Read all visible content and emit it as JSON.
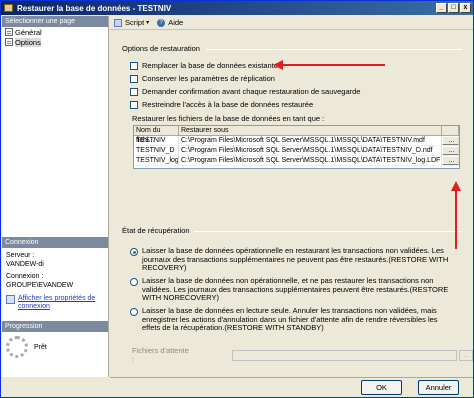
{
  "window": {
    "title": "Restaurer la base de données - TESTNIV",
    "min_label": "_",
    "max_label": "□",
    "close_label": "x"
  },
  "sidebar": {
    "header": "Sélectionner une page",
    "items": [
      {
        "label": "Général",
        "icon": "page-icon"
      },
      {
        "label": "Options",
        "icon": "page-icon"
      }
    ],
    "connection": {
      "header": "Connexion",
      "server_label": "Serveur :",
      "server_value": "VANDEW-di",
      "conn_label": "Connexion :",
      "conn_value": "GROUPE\\EVANDEW",
      "view_props_link": "Afficher les propriétés de connexion"
    },
    "progress": {
      "header": "Progression",
      "status": "Prêt"
    }
  },
  "toolbar": {
    "script_label": "Script",
    "help_label": "Aide"
  },
  "restore_options": {
    "group_label": "Options de restauration",
    "checkboxes": [
      {
        "label": "Remplacer la base de données existante",
        "checked": false
      },
      {
        "label": "Conserver les paramètres de réplication",
        "checked": false
      },
      {
        "label": "Demander confirmation avant chaque restauration de sauvegarde",
        "checked": false
      },
      {
        "label": "Restreindre l'accès à la base de données restaurée",
        "checked": false
      }
    ]
  },
  "files_grid": {
    "label": "Restaurer les fichiers de la base de données en tant que :",
    "columns": [
      "Nom du fichi...",
      "Restaurer sous"
    ],
    "rows": [
      {
        "name": "TESTNIV",
        "path": "C:\\Program Files\\Microsoft SQL Server\\MSSQL.1\\MSSQL\\DATA\\TESTNIV.mdf",
        "button": "..."
      },
      {
        "name": "TESTNIV_D",
        "path": "C:\\Program Files\\Microsoft SQL Server\\MSSQL.1\\MSSQL\\DATA\\TESTNIV_D.ndf",
        "button": "..."
      },
      {
        "name": "TESTNIV_log",
        "path": "C:\\Program Files\\Microsoft SQL Server\\MSSQL.1\\MSSQL\\DATA\\TESTNIV_log.LDF",
        "button": "..."
      }
    ]
  },
  "recovery": {
    "group_label": "État de récupération",
    "options": [
      {
        "text": "Laisser la base de données opérationnelle en restaurant les transactions non validées. Les journaux des transactions supplémentaires ne peuvent pas être restaurés.(RESTORE WITH RECOVERY)",
        "selected": true
      },
      {
        "text": "Laisser la base de données non opérationnelle, et ne pas restaurer les transactions non validées. Les journaux des transactions supplémentaires peuvent être restaurés.(RESTORE WITH NORECOVERY)",
        "selected": false
      },
      {
        "text": "Laisser la base de données en lecture seule. Annuler les transactions non validées, mais enregistrer les actions d'annulation dans un fichier d'attente afin de rendre réversibles les effets de la récupération.(RESTORE WITH STANDBY)",
        "selected": false
      }
    ],
    "standby_label": "Fichiers d'attente :",
    "standby_value": "",
    "standby_button": "..."
  },
  "buttons": {
    "ok": "OK",
    "cancel": "Annuler"
  },
  "colors": {
    "annotation_arrow": "#e02020",
    "titlebar": "#0a246a"
  }
}
